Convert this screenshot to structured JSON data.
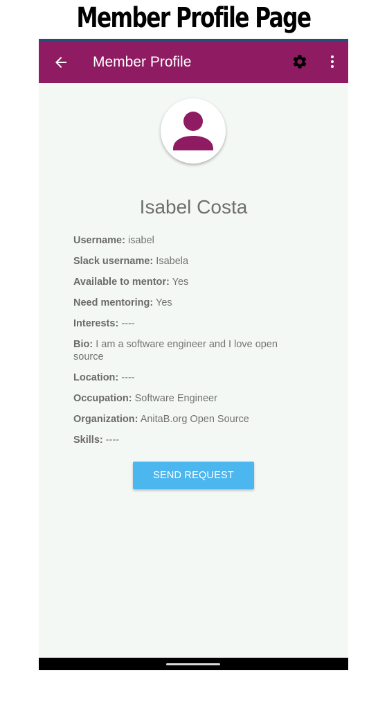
{
  "caption": "Member Profile Page",
  "appbar": {
    "title": "Member Profile",
    "back_icon": "arrow-back-icon",
    "settings_icon": "gear-icon",
    "more_icon": "more-vert-icon",
    "color": "#8f1c63"
  },
  "profile": {
    "avatar_icon": "person-icon",
    "name": "Isabel Costa",
    "fields": [
      {
        "label": "Username:",
        "value": "isabel"
      },
      {
        "label": "Slack username:",
        "value": "Isabela"
      },
      {
        "label": "Available to mentor:",
        "value": "Yes"
      },
      {
        "label": "Need mentoring:",
        "value": "Yes"
      },
      {
        "label": "Interests:",
        "value": "----"
      },
      {
        "label": "Bio:",
        "value": "I am a software engineer and I love open source"
      },
      {
        "label": "Location:",
        "value": "----"
      },
      {
        "label": "Occupation:",
        "value": "Software Engineer"
      },
      {
        "label": "Organization:",
        "value": "AnitaB.org Open Source"
      },
      {
        "label": "Skills:",
        "value": "----"
      }
    ]
  },
  "actions": {
    "send_request_label": "SEND REQUEST",
    "button_color": "#4cb6ef"
  }
}
